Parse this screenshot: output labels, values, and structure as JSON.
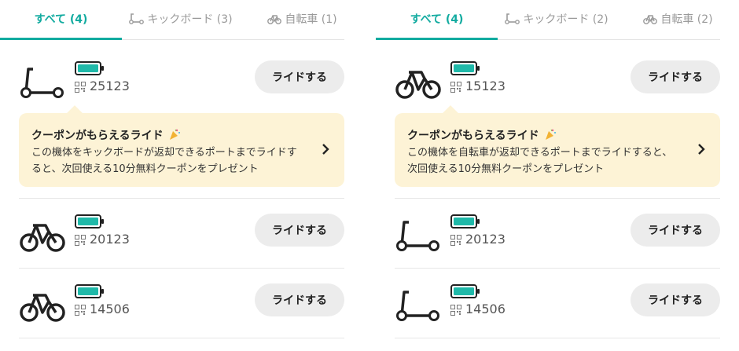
{
  "panels": [
    {
      "tabs": [
        {
          "label": "すべて (4)",
          "active": true
        },
        {
          "label": "キックボード (3)",
          "icon": "kickboard-icon"
        },
        {
          "label": "自転車 (1)",
          "icon": "bicycle-icon"
        }
      ],
      "coupon": {
        "title": "クーポンがもらえるライド",
        "body": "この機体をキックボードが返却できるポートまでライドすると、次回使える10分無料クーポンをプレゼント"
      },
      "vehicles": [
        {
          "id": "25123",
          "type": "kickboard",
          "button": "ライドする"
        },
        {
          "id": "20123",
          "type": "bicycle",
          "button": "ライドする"
        },
        {
          "id": "14506",
          "type": "bicycle",
          "button": "ライドする"
        }
      ]
    },
    {
      "tabs": [
        {
          "label": "すべて (4)",
          "active": true
        },
        {
          "label": "キックボード (2)",
          "icon": "kickboard-icon"
        },
        {
          "label": "自転車 (2)",
          "icon": "bicycle-icon"
        }
      ],
      "coupon": {
        "title": "クーポンがもらえるライド",
        "body": "この機体を自転車が返却できるポートまでライドすると、次回使える10分無料クーポンをプレゼント"
      },
      "vehicles": [
        {
          "id": "15123",
          "type": "bicycle",
          "button": "ライドする"
        },
        {
          "id": "20123",
          "type": "kickboard",
          "button": "ライドする"
        },
        {
          "id": "14506",
          "type": "kickboard",
          "button": "ライドする"
        }
      ]
    }
  ],
  "colors": {
    "accent": "#12aba0",
    "battery": "#1fb9a9",
    "coupon_bg": "#fdf3d6"
  }
}
